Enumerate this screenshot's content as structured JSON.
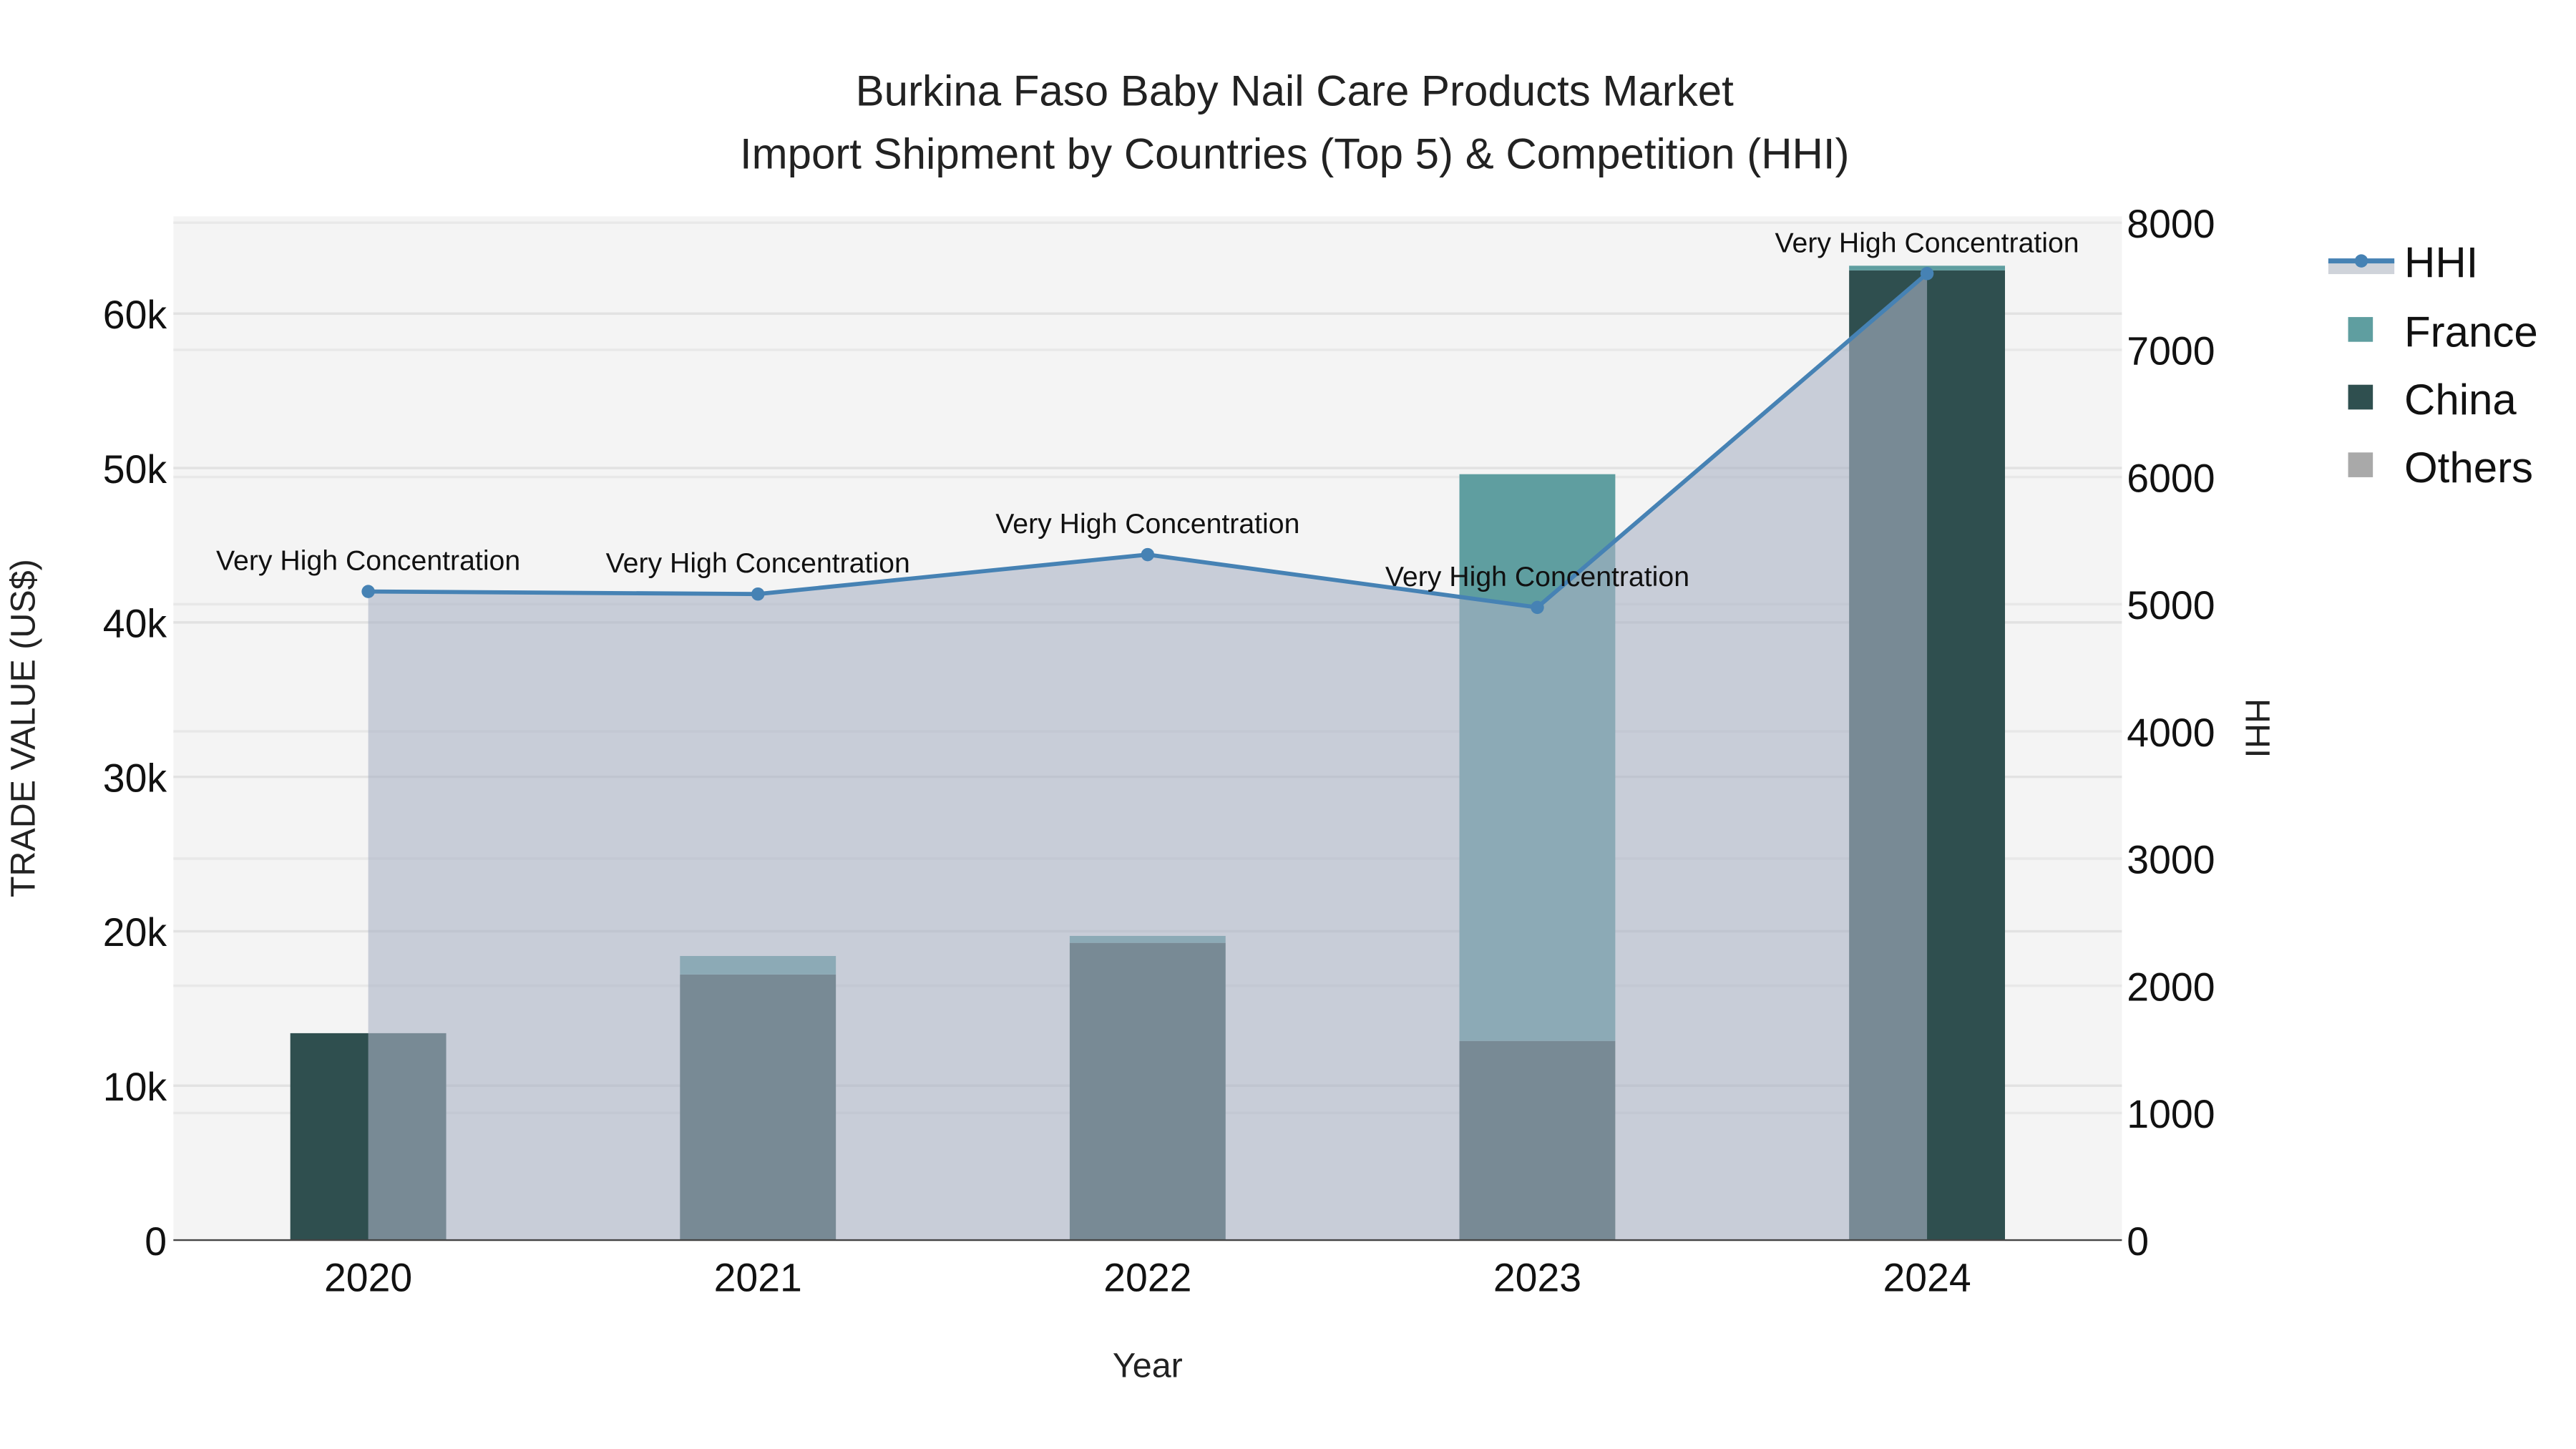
{
  "chart_data": {
    "type": "bar",
    "title": "Burkina Faso Baby Nail Care Products Market",
    "subtitle": "Import Shipment by Countries (Top 5) & Competition (HHI)",
    "xlabel": "Year",
    "ylabel": "TRADE VALUE (US$)",
    "y2label": "HHI",
    "categories": [
      "2020",
      "2021",
      "2022",
      "2023",
      "2024"
    ],
    "stacked": true,
    "ylim": [
      0,
      66300
    ],
    "y2lim": [
      0,
      8050
    ],
    "yticks": [
      0,
      10000,
      20000,
      30000,
      40000,
      50000,
      60000
    ],
    "ytick_labels": [
      "0",
      "10k",
      "20k",
      "30k",
      "40k",
      "50k",
      "60k"
    ],
    "y2ticks": [
      0,
      1000,
      2000,
      3000,
      4000,
      5000,
      6000,
      7000,
      8000
    ],
    "y2tick_labels": [
      "0",
      "1000",
      "2000",
      "3000",
      "4000",
      "5000",
      "6000",
      "7000",
      "8000"
    ],
    "series": [
      {
        "name": "China",
        "color": "#2f4f4f",
        "values": [
          13400,
          17200,
          19250,
          12900,
          62800
        ]
      },
      {
        "name": "France",
        "color": "#5f9ea0",
        "values": [
          0,
          1200,
          450,
          36700,
          300
        ]
      },
      {
        "name": "Others",
        "color": "#a9a9a9",
        "values": [
          0,
          0,
          0,
          0,
          0
        ]
      }
    ],
    "hhi": {
      "name": "HHI",
      "color": "#4682b4",
      "fill": "rgba(170,178,196,0.6)",
      "values": [
        5100,
        5080,
        5390,
        4975,
        7600
      ],
      "annotations": [
        "Very High Concentration",
        "Very High Concentration",
        "Very High Concentration",
        "Very High Concentration",
        "Very High Concentration"
      ]
    },
    "legend": {
      "position": "right",
      "entries": [
        "HHI",
        "France",
        "China",
        "Others"
      ]
    },
    "grid": true
  }
}
